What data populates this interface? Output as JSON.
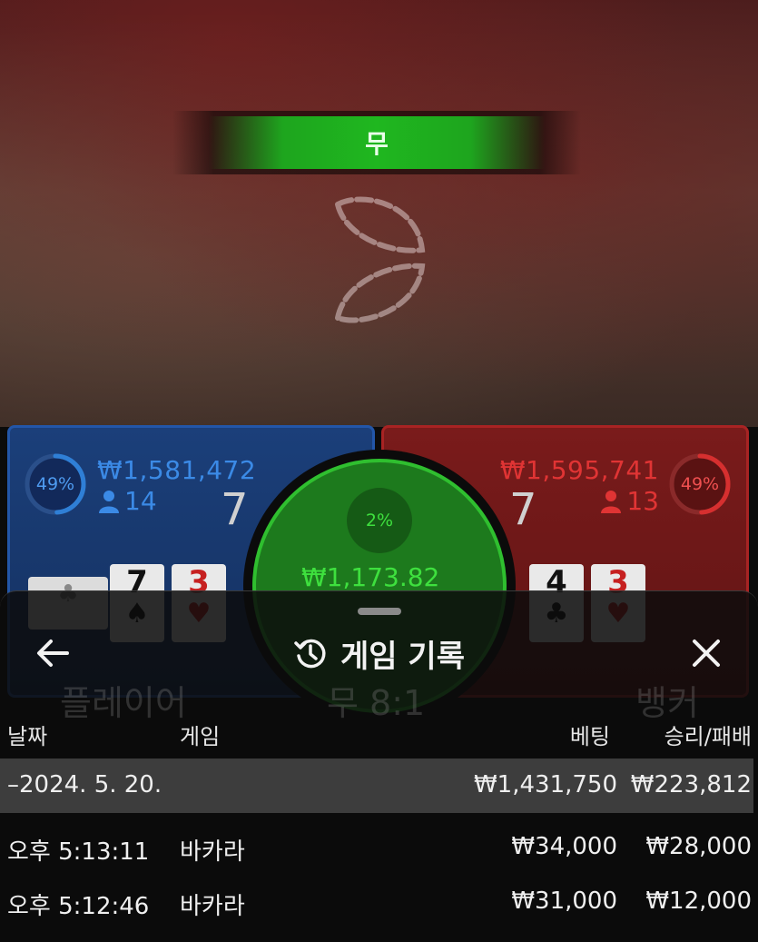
{
  "stage": {
    "result_label": "무"
  },
  "player_panel": {
    "percent": "49%",
    "percent_value": 0.49,
    "amount": "₩1,581,472",
    "bettors": "14",
    "score": "7",
    "ghost_label": "플레이어",
    "cards": [
      {
        "rank": "",
        "suit": "♣",
        "color": "black",
        "face_down": true
      },
      {
        "rank": "7",
        "suit": "♠",
        "color": "black"
      },
      {
        "rank": "3",
        "suit": "♥",
        "color": "red"
      }
    ]
  },
  "tie_panel": {
    "percent": "2%",
    "amount": "₩1,173.82",
    "ghost_label": "무 8:1"
  },
  "banker_panel": {
    "percent": "49%",
    "percent_value": 0.49,
    "amount": "₩1,595,741",
    "bettors": "13",
    "score": "7",
    "ghost_label": "뱅커",
    "cards": [
      {
        "rank": "4",
        "suit": "♣",
        "color": "black"
      },
      {
        "rank": "3",
        "suit": "♥",
        "color": "red"
      }
    ]
  },
  "sheet": {
    "title": "게임 기록",
    "columns": {
      "date": "날짜",
      "game": "게임",
      "bet": "베팅",
      "win_loss": "승리/패배"
    },
    "date_group": {
      "label": "–2024. 5. 20.",
      "bet_total": "₩1,431,750",
      "win_total": "₩223,812"
    },
    "rows": [
      {
        "time": "오후 5:13:11",
        "game": "바카라",
        "bet": "₩34,000",
        "result": "₩28,000"
      },
      {
        "time": "오후 5:12:46",
        "game": "바카라",
        "bet": "₩31,000",
        "result": "₩12,000"
      }
    ]
  },
  "colors": {
    "player_blue": "#2f7fd6",
    "banker_red": "#d62f2f",
    "tie_green": "#2fbf2f"
  }
}
